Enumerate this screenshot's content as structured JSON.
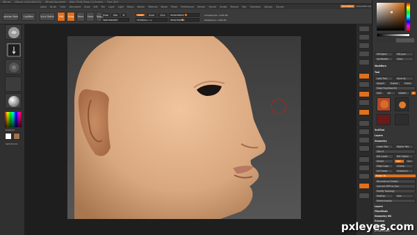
{
  "titlebar": {
    "app": "ZBrush",
    "items": [
      "ZBrush 4 [CS4 MAC/CS]",
      "ZBrush Document",
      "[Max 7919] [Temp 11] Scratch",
      "Free 1024"
    ]
  },
  "menubar": {
    "items": [
      "Alpha",
      "Brush",
      "Color",
      "Document",
      "Draw",
      "Edit",
      "File",
      "Layer",
      "Light",
      "Macro",
      "Marker",
      "Material",
      "Movie",
      "Picker",
      "Preferences",
      "Render",
      "Stencil",
      "Stroke",
      "Texture",
      "Tool",
      "Transform",
      "Zplugin",
      "Zscript"
    ],
    "quicksave": "QuickSave",
    "script": "DefaultZScript"
  },
  "topshelf": {
    "projection_master": "Projection Master",
    "lightbox": "LightBox",
    "quick_sketch": "Quick Sketch",
    "edit": "Edit",
    "draw": "Draw",
    "move": "Move",
    "scale": "Scale",
    "rotate": "Rotate",
    "mrgb": "Mrgb",
    "rgb": "Rgb",
    "m": "M",
    "zadd": "Zadd",
    "zsub": "Zsub",
    "zcut": "Zcut",
    "rgb_intensity": "Rgb Intensity",
    "z_intensity": "Z Intensity 12",
    "focal_shift": "Focal Shift 0",
    "draw_size": "Draw Size 64",
    "active_points": "ActivePoints: 1.005 Mil",
    "total_points": "TotalPoints: 1.005 Mil"
  },
  "leftpanel": {
    "gradient_label": "Gradient",
    "switch_color": "SwitchColor"
  },
  "trays": {
    "spix": "SPix",
    "fill_object": "FillObject",
    "fill_layer": "FillLayer",
    "sys_palette": "SysPalette",
    "clear": "Clear",
    "modifiers": "Modifiers",
    "tool_header": "Tool",
    "load_tool": "Load Tool",
    "save_as": "Save As",
    "import": "Import",
    "export": "Export",
    "clone": "Clone",
    "make_polymesh": "Make PolyMesh3D",
    "goz": "GoZ",
    "all": "All",
    "visible": "Visible",
    "r": "R",
    "subtool": "SubTool",
    "layers": "Layers",
    "geometry": "Geometry",
    "lower_res": "Lower Res",
    "higher_res": "Higher Res",
    "sdiv": "SDiv 6",
    "del_lower": "Del Lower",
    "del_higher": "Del Higher",
    "divide": "Divide",
    "smt": "Smt",
    "suv": "Suv",
    "edge_loop": "Edge Loop",
    "crease": "Crease",
    "uncrease": "UnCrease",
    "creaselvl": "CreaseLvl",
    "polish": "Polish 35",
    "reconstruct": "Reconstruct Subdiv",
    "convert_bpr": "Convert BPR to Geo",
    "modify_topology": "Modify Topology",
    "position": "Position",
    "size": "Size",
    "meshintegrity": "MeshIntegrity",
    "layers2": "Layers",
    "fibermesh": "FiberMesh",
    "geometry_hd": "Geometry HD",
    "preview": "Preview",
    "surface": "Surface",
    "deformation": "Deformation",
    "masking": "Masking",
    "visibility": "Visibility",
    "polygroups": "Polygroups",
    "contact": "Contact",
    "morph_target": "Morph Target",
    "polypaint": "Polypaint",
    "uv_map": "UV Map",
    "texture_map": "Texture Map",
    "displacement_map": "Displacement Map",
    "normal_map": "Normal Map",
    "vector_displacement": "Vector Displacement Map",
    "display_properties": "Display Properties",
    "unified_skin": "Unified Skin",
    "import2": "Import",
    "export2": "Export"
  },
  "colors": {
    "accent": "#e0701c",
    "background": "#2b2b2b",
    "skin": "#d9a77e"
  },
  "watermark": "pxleyes.com"
}
